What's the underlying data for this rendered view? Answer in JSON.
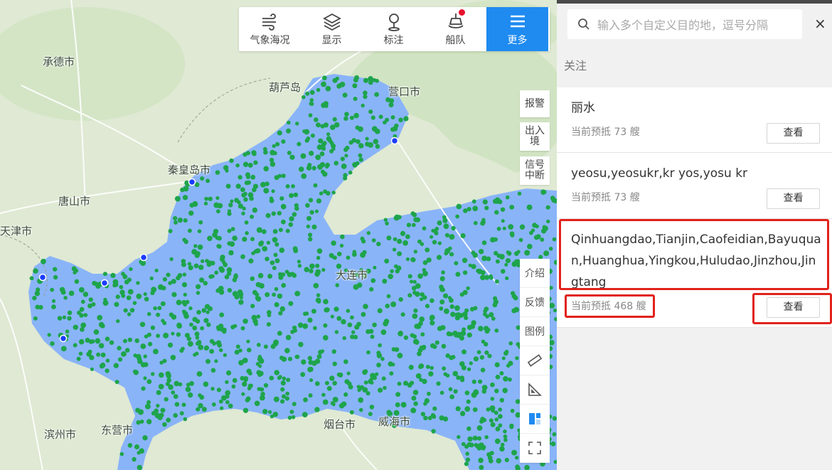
{
  "toolbar": {
    "items": [
      {
        "label": "气象海况",
        "icon": "wind-icon"
      },
      {
        "label": "显示",
        "icon": "layers-icon"
      },
      {
        "label": "标注",
        "icon": "pin-icon"
      },
      {
        "label": "船队",
        "icon": "ship-icon"
      },
      {
        "label": "更多",
        "icon": "menu-icon"
      }
    ],
    "accent": "#1f8bf0",
    "badge_color": "#e8112d"
  },
  "map_side_tools": {
    "alarm": "报警",
    "entry_exit": "出入境",
    "signal_loss": "信号中断",
    "intro": "介绍",
    "feedback": "反馈",
    "legend": "图例"
  },
  "map_labels": {
    "chengde": "承德市",
    "huludao": "葫芦岛",
    "yingkou": "营口市",
    "qinhuangdao": "秦皇岛市",
    "tangshan": "唐山市",
    "tianjin": "天津市",
    "dalian": "大连市",
    "binzhou": "滨州市",
    "dongying": "东营市",
    "yantai": "烟台市",
    "weihai": "威海市"
  },
  "map_colors": {
    "sea": "#8ab4f8",
    "land": "#dfe9d3",
    "ship": "#1ea44b"
  },
  "panel": {
    "search_placeholder": "输入多个自定义目的地，逗号分隔",
    "close": "×",
    "section_label": "关注",
    "cards": [
      {
        "name": "丽水",
        "meta": "当前预抵 73 艘",
        "button": "查看"
      },
      {
        "name": "yeosu,yeosukr,kr yos,yosu kr",
        "meta": "当前预抵 73 艘",
        "button": "查看"
      },
      {
        "name": "Qinhuangdao,Tianjin,Caofeidian,Bayuquan,Huanghua,Yingkou,Huludao,Jinzhou,Jingtang",
        "meta": "当前预抵 468 艘",
        "button": "查看"
      }
    ]
  }
}
